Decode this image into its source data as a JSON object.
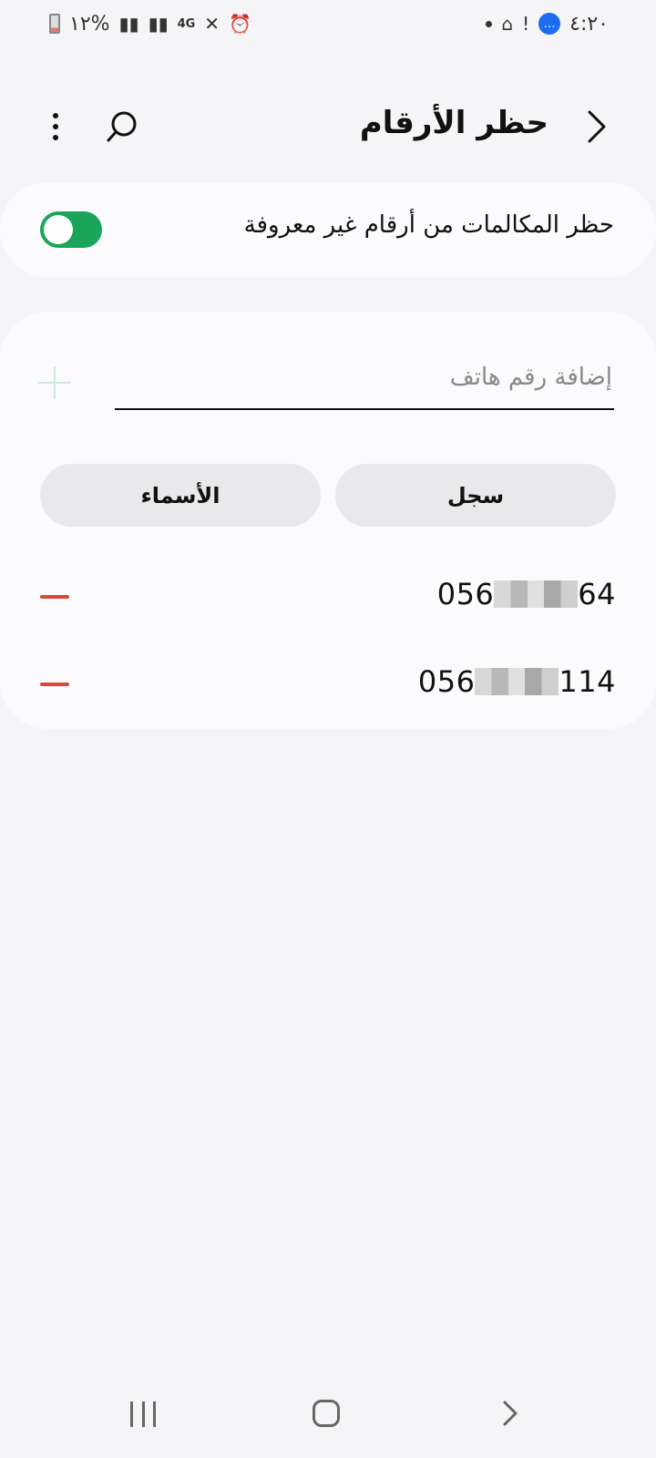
{
  "status_bar": {
    "time": "٤:٢٠",
    "battery_percent": "%١٢",
    "network": "4G",
    "icons": [
      "messages-icon",
      "alert-icon",
      "mosque-icon",
      "dot-icon",
      "alarm-icon",
      "mute-icon",
      "network-4g-icon",
      "signal-icon",
      "signal-icon",
      "battery-icon"
    ]
  },
  "header": {
    "title": "حظر الأرقام",
    "icons": [
      "back-icon",
      "search-icon",
      "more-options-icon"
    ]
  },
  "block_unknown": {
    "label": "حظر المكالمات من أرقام غير معروفة",
    "enabled": true
  },
  "add_number": {
    "placeholder": "إضافة رقم هاتف"
  },
  "buttons": {
    "log": "سجل",
    "contacts": "الأسماء"
  },
  "blocked_numbers": [
    {
      "prefix": "056",
      "suffix": "64"
    },
    {
      "prefix": "056",
      "suffix": "114"
    }
  ],
  "colors": {
    "toggle_on": "#1aa55a",
    "remove": "#d8473a",
    "plus": "#cfe9e0"
  }
}
